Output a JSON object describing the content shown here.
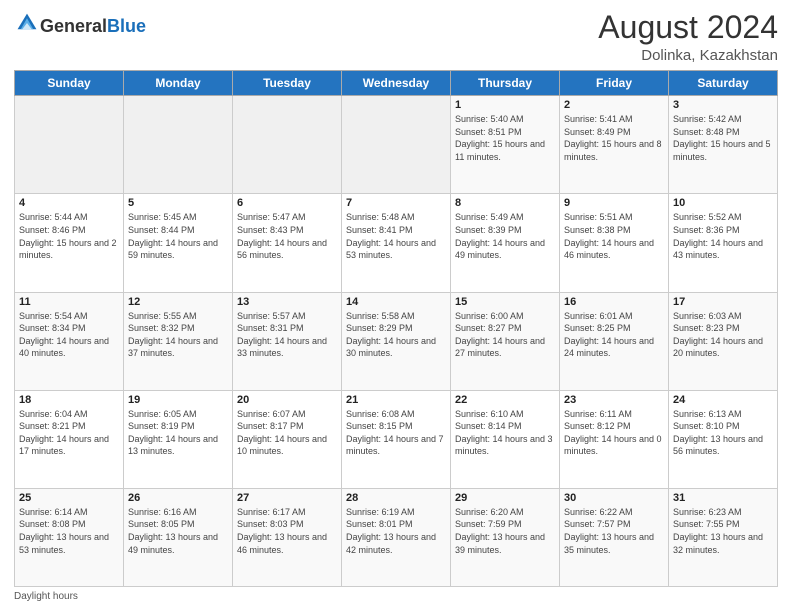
{
  "header": {
    "logo_general": "General",
    "logo_blue": "Blue",
    "month_year": "August 2024",
    "location": "Dolinka, Kazakhstan"
  },
  "days_header": [
    "Sunday",
    "Monday",
    "Tuesday",
    "Wednesday",
    "Thursday",
    "Friday",
    "Saturday"
  ],
  "footer": {
    "daylight_hours": "Daylight hours"
  },
  "weeks": [
    {
      "days": [
        {
          "num": "",
          "empty": true,
          "sunrise": "",
          "sunset": "",
          "daylight": ""
        },
        {
          "num": "",
          "empty": true,
          "sunrise": "",
          "sunset": "",
          "daylight": ""
        },
        {
          "num": "",
          "empty": true,
          "sunrise": "",
          "sunset": "",
          "daylight": ""
        },
        {
          "num": "",
          "empty": true,
          "sunrise": "",
          "sunset": "",
          "daylight": ""
        },
        {
          "num": "1",
          "empty": false,
          "sunrise": "Sunrise: 5:40 AM",
          "sunset": "Sunset: 8:51 PM",
          "daylight": "Daylight: 15 hours and 11 minutes."
        },
        {
          "num": "2",
          "empty": false,
          "sunrise": "Sunrise: 5:41 AM",
          "sunset": "Sunset: 8:49 PM",
          "daylight": "Daylight: 15 hours and 8 minutes."
        },
        {
          "num": "3",
          "empty": false,
          "sunrise": "Sunrise: 5:42 AM",
          "sunset": "Sunset: 8:48 PM",
          "daylight": "Daylight: 15 hours and 5 minutes."
        }
      ]
    },
    {
      "days": [
        {
          "num": "4",
          "empty": false,
          "sunrise": "Sunrise: 5:44 AM",
          "sunset": "Sunset: 8:46 PM",
          "daylight": "Daylight: 15 hours and 2 minutes."
        },
        {
          "num": "5",
          "empty": false,
          "sunrise": "Sunrise: 5:45 AM",
          "sunset": "Sunset: 8:44 PM",
          "daylight": "Daylight: 14 hours and 59 minutes."
        },
        {
          "num": "6",
          "empty": false,
          "sunrise": "Sunrise: 5:47 AM",
          "sunset": "Sunset: 8:43 PM",
          "daylight": "Daylight: 14 hours and 56 minutes."
        },
        {
          "num": "7",
          "empty": false,
          "sunrise": "Sunrise: 5:48 AM",
          "sunset": "Sunset: 8:41 PM",
          "daylight": "Daylight: 14 hours and 53 minutes."
        },
        {
          "num": "8",
          "empty": false,
          "sunrise": "Sunrise: 5:49 AM",
          "sunset": "Sunset: 8:39 PM",
          "daylight": "Daylight: 14 hours and 49 minutes."
        },
        {
          "num": "9",
          "empty": false,
          "sunrise": "Sunrise: 5:51 AM",
          "sunset": "Sunset: 8:38 PM",
          "daylight": "Daylight: 14 hours and 46 minutes."
        },
        {
          "num": "10",
          "empty": false,
          "sunrise": "Sunrise: 5:52 AM",
          "sunset": "Sunset: 8:36 PM",
          "daylight": "Daylight: 14 hours and 43 minutes."
        }
      ]
    },
    {
      "days": [
        {
          "num": "11",
          "empty": false,
          "sunrise": "Sunrise: 5:54 AM",
          "sunset": "Sunset: 8:34 PM",
          "daylight": "Daylight: 14 hours and 40 minutes."
        },
        {
          "num": "12",
          "empty": false,
          "sunrise": "Sunrise: 5:55 AM",
          "sunset": "Sunset: 8:32 PM",
          "daylight": "Daylight: 14 hours and 37 minutes."
        },
        {
          "num": "13",
          "empty": false,
          "sunrise": "Sunrise: 5:57 AM",
          "sunset": "Sunset: 8:31 PM",
          "daylight": "Daylight: 14 hours and 33 minutes."
        },
        {
          "num": "14",
          "empty": false,
          "sunrise": "Sunrise: 5:58 AM",
          "sunset": "Sunset: 8:29 PM",
          "daylight": "Daylight: 14 hours and 30 minutes."
        },
        {
          "num": "15",
          "empty": false,
          "sunrise": "Sunrise: 6:00 AM",
          "sunset": "Sunset: 8:27 PM",
          "daylight": "Daylight: 14 hours and 27 minutes."
        },
        {
          "num": "16",
          "empty": false,
          "sunrise": "Sunrise: 6:01 AM",
          "sunset": "Sunset: 8:25 PM",
          "daylight": "Daylight: 14 hours and 24 minutes."
        },
        {
          "num": "17",
          "empty": false,
          "sunrise": "Sunrise: 6:03 AM",
          "sunset": "Sunset: 8:23 PM",
          "daylight": "Daylight: 14 hours and 20 minutes."
        }
      ]
    },
    {
      "days": [
        {
          "num": "18",
          "empty": false,
          "sunrise": "Sunrise: 6:04 AM",
          "sunset": "Sunset: 8:21 PM",
          "daylight": "Daylight: 14 hours and 17 minutes."
        },
        {
          "num": "19",
          "empty": false,
          "sunrise": "Sunrise: 6:05 AM",
          "sunset": "Sunset: 8:19 PM",
          "daylight": "Daylight: 14 hours and 13 minutes."
        },
        {
          "num": "20",
          "empty": false,
          "sunrise": "Sunrise: 6:07 AM",
          "sunset": "Sunset: 8:17 PM",
          "daylight": "Daylight: 14 hours and 10 minutes."
        },
        {
          "num": "21",
          "empty": false,
          "sunrise": "Sunrise: 6:08 AM",
          "sunset": "Sunset: 8:15 PM",
          "daylight": "Daylight: 14 hours and 7 minutes."
        },
        {
          "num": "22",
          "empty": false,
          "sunrise": "Sunrise: 6:10 AM",
          "sunset": "Sunset: 8:14 PM",
          "daylight": "Daylight: 14 hours and 3 minutes."
        },
        {
          "num": "23",
          "empty": false,
          "sunrise": "Sunrise: 6:11 AM",
          "sunset": "Sunset: 8:12 PM",
          "daylight": "Daylight: 14 hours and 0 minutes."
        },
        {
          "num": "24",
          "empty": false,
          "sunrise": "Sunrise: 6:13 AM",
          "sunset": "Sunset: 8:10 PM",
          "daylight": "Daylight: 13 hours and 56 minutes."
        }
      ]
    },
    {
      "days": [
        {
          "num": "25",
          "empty": false,
          "sunrise": "Sunrise: 6:14 AM",
          "sunset": "Sunset: 8:08 PM",
          "daylight": "Daylight: 13 hours and 53 minutes."
        },
        {
          "num": "26",
          "empty": false,
          "sunrise": "Sunrise: 6:16 AM",
          "sunset": "Sunset: 8:05 PM",
          "daylight": "Daylight: 13 hours and 49 minutes."
        },
        {
          "num": "27",
          "empty": false,
          "sunrise": "Sunrise: 6:17 AM",
          "sunset": "Sunset: 8:03 PM",
          "daylight": "Daylight: 13 hours and 46 minutes."
        },
        {
          "num": "28",
          "empty": false,
          "sunrise": "Sunrise: 6:19 AM",
          "sunset": "Sunset: 8:01 PM",
          "daylight": "Daylight: 13 hours and 42 minutes."
        },
        {
          "num": "29",
          "empty": false,
          "sunrise": "Sunrise: 6:20 AM",
          "sunset": "Sunset: 7:59 PM",
          "daylight": "Daylight: 13 hours and 39 minutes."
        },
        {
          "num": "30",
          "empty": false,
          "sunrise": "Sunrise: 6:22 AM",
          "sunset": "Sunset: 7:57 PM",
          "daylight": "Daylight: 13 hours and 35 minutes."
        },
        {
          "num": "31",
          "empty": false,
          "sunrise": "Sunrise: 6:23 AM",
          "sunset": "Sunset: 7:55 PM",
          "daylight": "Daylight: 13 hours and 32 minutes."
        }
      ]
    }
  ]
}
